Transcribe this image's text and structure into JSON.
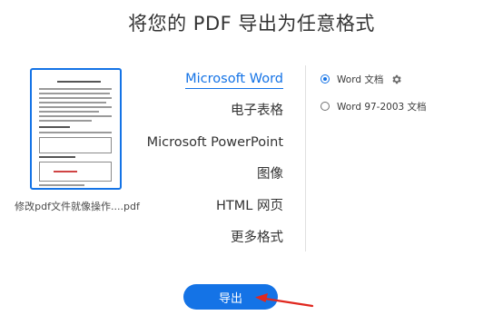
{
  "page": {
    "title": "将您的 PDF 导出为任意格式"
  },
  "file": {
    "name": "修改pdf文件就像操作....pdf"
  },
  "formats": [
    {
      "label": "Microsoft Word",
      "selected": true
    },
    {
      "label": "电子表格",
      "selected": false
    },
    {
      "label": "Microsoft PowerPoint",
      "selected": false
    },
    {
      "label": "图像",
      "selected": false
    },
    {
      "label": "HTML 网页",
      "selected": false
    },
    {
      "label": "更多格式",
      "selected": false
    }
  ],
  "options": [
    {
      "label": "Word 文档",
      "checked": true,
      "settings_icon": "gear-icon"
    },
    {
      "label": "Word 97-2003 文档",
      "checked": false
    }
  ],
  "export_button": {
    "label": "导出"
  },
  "colors": {
    "accent": "#1473e6",
    "annotation_arrow": "#e0281f"
  }
}
